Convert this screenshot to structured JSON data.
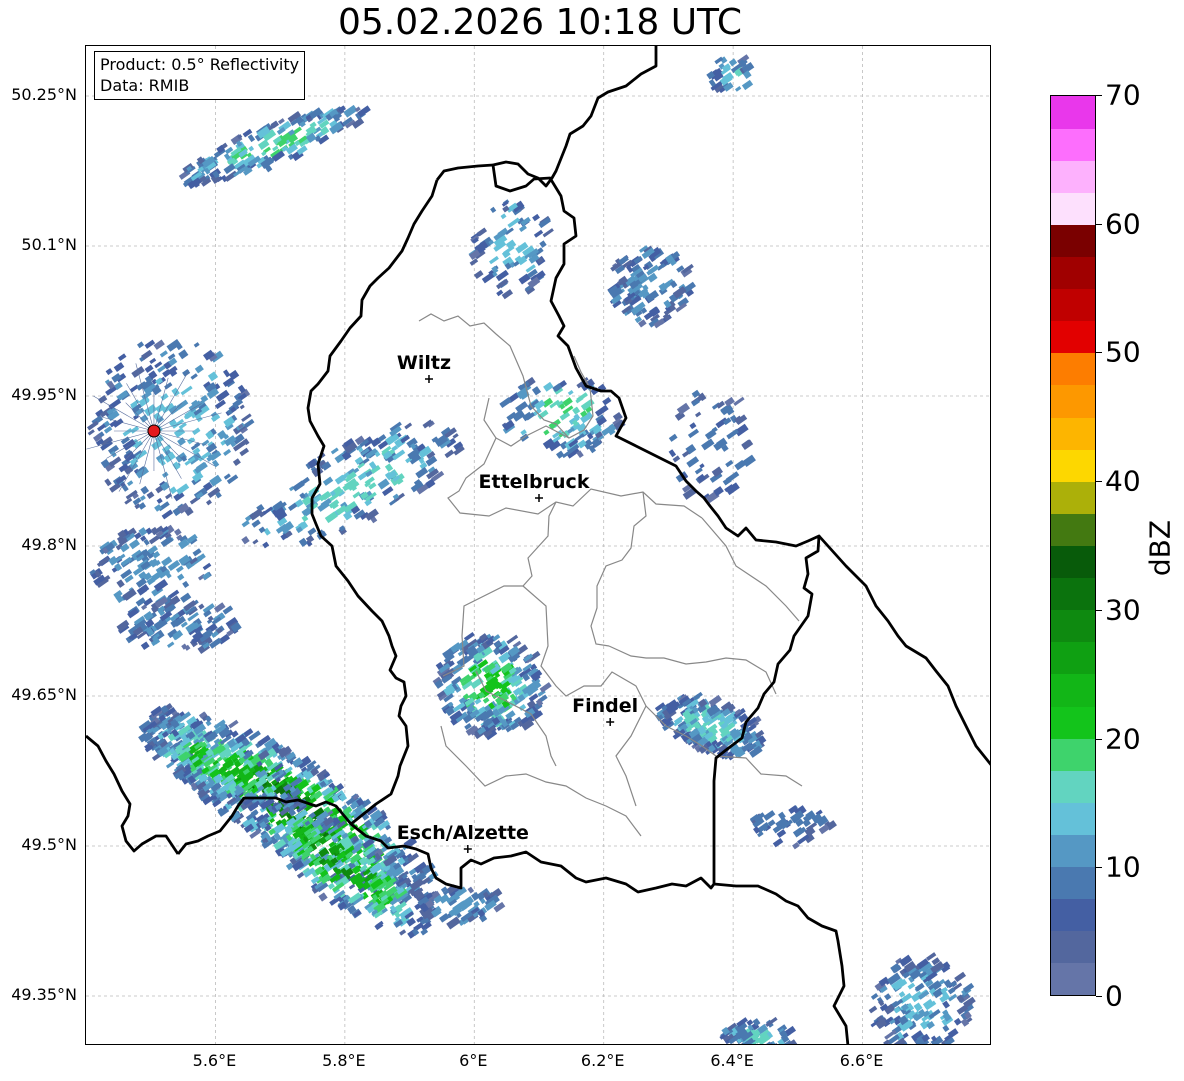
{
  "title": "05.02.2026 10:18 UTC",
  "info": {
    "product": "Product: 0.5° Reflectivity",
    "data": "Data: RMIB"
  },
  "map": {
    "lon_range": [
      5.4,
      6.8
    ],
    "lat_range": [
      49.3,
      50.3
    ],
    "x_ticks": [
      "5.6°E",
      "5.8°E",
      "6°E",
      "6.2°E",
      "6.4°E",
      "6.6°E"
    ],
    "x_tick_values": [
      5.6,
      5.8,
      6.0,
      6.2,
      6.4,
      6.6
    ],
    "y_ticks": [
      "50.25°N",
      "50.1°N",
      "49.95°N",
      "49.8°N",
      "49.65°N",
      "49.5°N",
      "49.35°N"
    ],
    "y_tick_values": [
      50.25,
      50.1,
      49.95,
      49.8,
      49.65,
      49.5,
      49.35
    ],
    "cities": [
      {
        "name": "Wiltz",
        "lon": 5.93,
        "lat": 49.967
      },
      {
        "name": "Ettelbruck",
        "lon": 6.1,
        "lat": 49.848
      },
      {
        "name": "Findel",
        "lon": 6.21,
        "lat": 49.624
      },
      {
        "name": "Esch/Alzette",
        "lon": 5.99,
        "lat": 49.497
      }
    ],
    "radar_site": {
      "lon": 5.505,
      "lat": 49.915,
      "color": "#e31a1c"
    },
    "country_border_color": "#000000",
    "canton_border_color": "#888888"
  },
  "colorbar": {
    "label": "dBZ",
    "min": 0,
    "max": 70,
    "tick_labels": [
      "0",
      "10",
      "20",
      "30",
      "40",
      "50",
      "60",
      "70"
    ],
    "colors": [
      "#6575a8",
      "#53679e",
      "#445fa3",
      "#4a79b0",
      "#5598c4",
      "#64c1d9",
      "#62d4c0",
      "#3ed36c",
      "#13c41b",
      "#12b617",
      "#0fa012",
      "#0e8a10",
      "#0b730d",
      "#085b0a",
      "#437911",
      "#acb009",
      "#fdd700",
      "#fdb500",
      "#fd9800",
      "#fd7d00",
      "#e20000",
      "#c00000",
      "#a00000",
      "#7a0000",
      "#fde0fd",
      "#fdb1fd",
      "#fd6efd",
      "#e937eb"
    ]
  }
}
